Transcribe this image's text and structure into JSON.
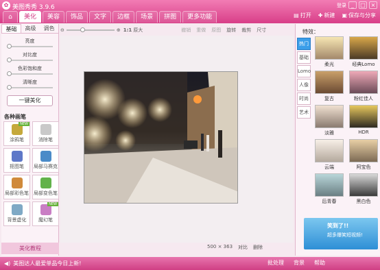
{
  "app": {
    "title": "美图秀秀 3.9.6",
    "login": "登录"
  },
  "nav": [
    "美化",
    "美容",
    "饰品",
    "文字",
    "边框",
    "场景",
    "拼图",
    "更多功能"
  ],
  "top": {
    "open": "打开",
    "new": "新建",
    "save": "保存与分享"
  },
  "left": {
    "tabs": [
      "基础",
      "高级",
      "调色"
    ],
    "sliders": [
      "亮度",
      "对比度",
      "色彩饱和度",
      "清晰度"
    ],
    "onekey": "一键美化",
    "brush_title": "各种画笔",
    "brushes": [
      {
        "label": "涂鸦笔",
        "color": "#c5a93b"
      },
      {
        "label": "消除笔",
        "color": "#c9c9c9"
      },
      {
        "label": "抠图笔",
        "color": "#5e78c8"
      },
      {
        "label": "局部马赛克",
        "color": "#4b8bc8"
      },
      {
        "label": "局部彩色笔",
        "color": "#d08a3b"
      },
      {
        "label": "局部变色笔",
        "color": "#62b24a"
      },
      {
        "label": "背景虚化",
        "color": "#7fa9c5"
      },
      {
        "label": "魔幻笔",
        "color": "#c97ec4"
      }
    ],
    "beauty": "美化教程"
  },
  "toolbar": {
    "zoom": "1:1",
    "orig": "原大",
    "undo": "撤销",
    "redo": "重做",
    "restore": "原图",
    "rotate": "旋转",
    "crop": "裁剪",
    "size": "尺寸"
  },
  "canvas": {
    "dims": "500 × 363",
    "compare": "对比",
    "delete": "删除"
  },
  "right": {
    "title": "特效：",
    "cats": [
      "热门",
      "基础",
      "Lomo",
      "人像",
      "时尚",
      "艺术"
    ],
    "effects": [
      {
        "label": "柔光",
        "c1": "#f6e6b3",
        "c2": "#a4896b"
      },
      {
        "label": "经典Lomo",
        "c1": "#d9a74a",
        "c2": "#4b3a26"
      },
      {
        "label": "复古",
        "c1": "#c9a06a",
        "c2": "#6b4a33"
      },
      {
        "label": "粉红佳人",
        "c1": "#efa9b7",
        "c2": "#6b4b57"
      },
      {
        "label": "淡雅",
        "c1": "#f0e0d0",
        "c2": "#8a7b70"
      },
      {
        "label": "HDR",
        "c1": "#e7c85d",
        "c2": "#2f2a22"
      },
      {
        "label": "云端",
        "c1": "#f7efe7",
        "c2": "#b5a99d"
      },
      {
        "label": "阿宝色",
        "c1": "#e8cfa5",
        "c2": "#7c6a54"
      },
      {
        "label": "后青春",
        "c1": "#b9d6d9",
        "c2": "#6a7f83"
      },
      {
        "label": "黑白色",
        "c1": "#d8d8d8",
        "c2": "#3b3b3b"
      }
    ],
    "ad_title": "笑到了!!",
    "ad_sub": "超多爆笑短视频!"
  },
  "status": {
    "msg": "美图达人最爱单品今日上新!",
    "batch": "批处理",
    "bg": "背景",
    "help": "帮助"
  }
}
